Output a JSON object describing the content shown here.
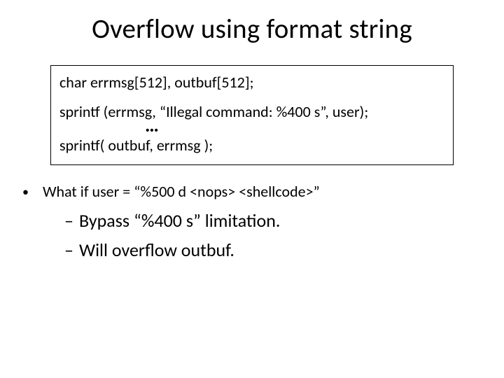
{
  "title": "Overflow using format string",
  "code": {
    "declaration": "char errmsg[512],  outbuf[512];",
    "sprintf1": "sprintf (errmsg, “Illegal command: %400 s”, user);",
    "ellipsis": "…",
    "sprintf2": "sprintf( outbuf, errmsg );"
  },
  "bullet": {
    "question": "What if   user = “%500 d <nops> <shellcode>”",
    "dash1": "Bypass  “%400 s”  limitation.",
    "dash2": "Will overflow outbuf."
  }
}
